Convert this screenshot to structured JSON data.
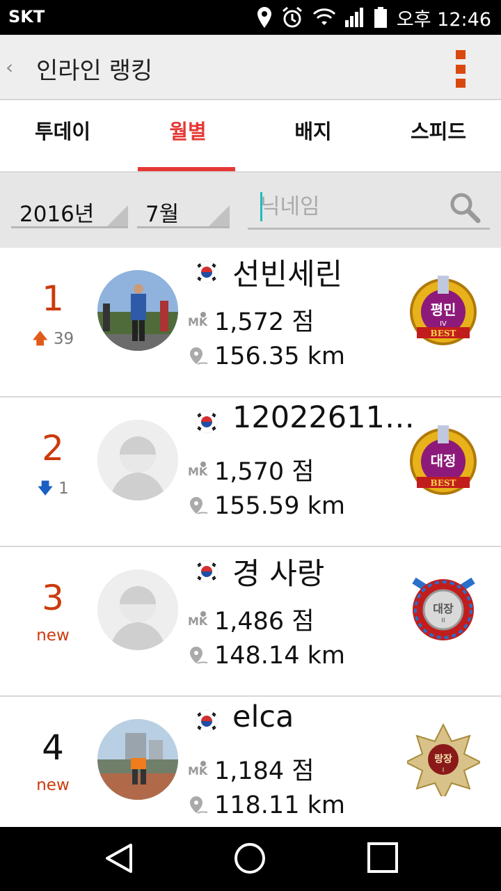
{
  "status_bar": {
    "carrier": "SKT",
    "time": "오후 12:46",
    "icons": [
      "location-icon",
      "alarm-icon",
      "wifi-icon",
      "signal-icon",
      "battery-icon"
    ]
  },
  "app_bar": {
    "back_glyph": "‹",
    "title": "인라인 랭킹",
    "menu_icon": "overflow-menu-icon",
    "accent_color": "#d9480f"
  },
  "tabs": [
    {
      "label": "투데이",
      "active": false
    },
    {
      "label": "월별",
      "active": true
    },
    {
      "label": "배지",
      "active": false
    },
    {
      "label": "스피드",
      "active": false
    }
  ],
  "tab_active_color": "#e53935",
  "filters": {
    "year": "2016년",
    "month": "7월",
    "search_placeholder": "닉네임"
  },
  "rankings": [
    {
      "rank": "1",
      "change_type": "up",
      "change_glyph": "🡅",
      "change_value": "39",
      "name": "선빈세린",
      "points": "1,572 점",
      "distance": "156.35 km",
      "badge_text": "평민"
    },
    {
      "rank": "2",
      "change_type": "down",
      "change_glyph": "🡇",
      "change_value": "1",
      "name": "12022611…",
      "points": "1,570 점",
      "distance": "155.59 km",
      "badge_text": "대정"
    },
    {
      "rank": "3",
      "change_type": "new",
      "change_glyph": "",
      "change_value": "new",
      "name": "경  사랑",
      "points": "1,486 점",
      "distance": "148.14 km",
      "badge_text": "대장"
    },
    {
      "rank": "4",
      "change_type": "new",
      "change_glyph": "",
      "change_value": "new",
      "name": "elca",
      "points": "1,184 점",
      "distance": "118.11 km",
      "badge_text": "랑장"
    }
  ],
  "nav_bar": {
    "icons": [
      "back-triangle-icon",
      "home-circle-icon",
      "recents-square-icon"
    ]
  }
}
